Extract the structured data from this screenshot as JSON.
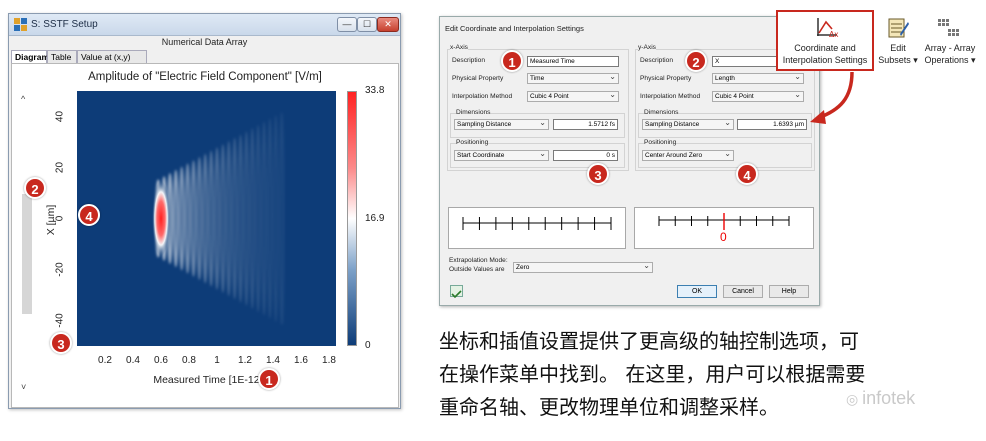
{
  "window": {
    "title": "S: SSTF Setup",
    "array_header": "Numerical Data Array",
    "tabs": [
      "Diagram",
      "Table",
      "Value at (x,y)"
    ],
    "buttons": {
      "minimize": "—",
      "maximize": "☐",
      "close": "✕"
    },
    "scroll_up": "^",
    "scroll_down": "˅"
  },
  "chart_data": {
    "type": "heatmap",
    "title": "Amplitude of \"Electric Field Component\"  [V/m]",
    "xlabel": "Measured Time [1E-12 s]",
    "ylabel": "X [µm]",
    "x_ticks": [
      "0.2",
      "0.4",
      "0.6",
      "0.8",
      "1",
      "1.2",
      "1.4",
      "1.6",
      "1.8"
    ],
    "x_tick_values": [
      0.2,
      0.4,
      0.6,
      0.8,
      1.0,
      1.2,
      1.4,
      1.6,
      1.8
    ],
    "y_ticks": [
      "40",
      "20",
      "0",
      "-20",
      "-40"
    ],
    "y_tick_values": [
      40,
      20,
      0,
      -20,
      -40
    ],
    "xlim": [
      0,
      1.85
    ],
    "ylim": [
      -50,
      50
    ],
    "colorbar_labels": [
      "33.8",
      "16.9",
      "0"
    ],
    "colorbar_values": [
      33.8,
      16.9,
      0
    ],
    "colors": {
      "low": "#0d3c78",
      "mid": "#ffffff",
      "high": "#ff1f1f"
    }
  },
  "markers": {
    "m1": "1",
    "m2": "2",
    "m3": "3",
    "m4": "4"
  },
  "dialog": {
    "title": "Edit Coordinate and Interpolation Settings",
    "x_axis": {
      "header": "x-Axis",
      "description_label": "Description",
      "description_value": "Measured Time",
      "physical_property_label": "Physical Property",
      "physical_property_value": "Time",
      "interpolation_label": "Interpolation Method",
      "interpolation_value": "Cubic 4 Point",
      "dimensions_label": "Dimensions",
      "sampling_select": "Sampling Distance",
      "sampling_value": "1.5712 fs",
      "positioning_label": "Positioning",
      "positioning_select": "Start Coordinate",
      "positioning_value": "0 s"
    },
    "y_axis": {
      "header": "y-Axis",
      "description_label": "Description",
      "description_value": "X",
      "physical_property_label": "Physical Property",
      "physical_property_value": "Length",
      "interpolation_label": "Interpolation Method",
      "interpolation_value": "Cubic 4 Point",
      "dimensions_label": "Dimensions",
      "sampling_select": "Sampling Distance",
      "sampling_value": "1.6393 µm",
      "positioning_label": "Positioning",
      "positioning_select": "Center Around Zero"
    },
    "y_preview_zero": "0",
    "extrapolation_label_1": "Extrapolation Mode:",
    "extrapolation_label_2": "Outside Values are",
    "extrapolation_value": "Zero",
    "ok": "OK",
    "cancel": "Cancel",
    "help": "Help"
  },
  "ribbon": {
    "coord_line1": "Coordinate and",
    "coord_line2": "Interpolation Settings",
    "edit_line1": "Edit",
    "edit_line2": "Subsets ▾",
    "array_line1": "Array - Array",
    "array_line2": "Operations ▾"
  },
  "caption": {
    "line1": "坐标和插值设置提供了更高级的轴控制选项，可",
    "line2": "在操作菜单中找到。 在这里，用户可以根据需要",
    "line3": "重命名轴、更改物理单位和调整采样。"
  },
  "watermark": "infotek"
}
